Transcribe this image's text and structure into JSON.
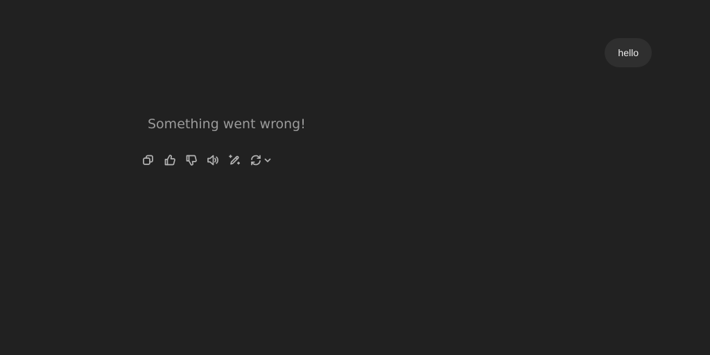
{
  "conversation": {
    "user_message": "hello",
    "assistant_message": "Something went wrong!"
  },
  "actions": [
    {
      "name": "copy",
      "icon": "copy-icon"
    },
    {
      "name": "good-response",
      "icon": "thumbs-up-icon"
    },
    {
      "name": "bad-response",
      "icon": "thumbs-down-icon"
    },
    {
      "name": "read-aloud",
      "icon": "speaker-icon"
    },
    {
      "name": "edit",
      "icon": "pencil-sparkle-icon"
    },
    {
      "name": "regenerate",
      "icon": "refresh-icon"
    }
  ],
  "colors": {
    "background": "#212121",
    "user_bubble": "#2f2f2f",
    "user_text": "#ececec",
    "assistant_text": "#9b9b9b",
    "icon": "#b4b4b4"
  }
}
